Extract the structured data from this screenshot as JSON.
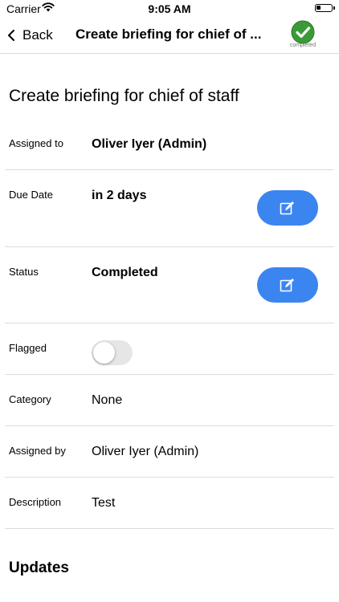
{
  "status_bar": {
    "carrier": "Carrier",
    "time": "9:05 AM"
  },
  "nav": {
    "back_label": "Back",
    "title": "Create briefing for chief of ...",
    "status_caption": "completed"
  },
  "page": {
    "title": "Create briefing for chief of staff"
  },
  "fields": {
    "assigned_to": {
      "label": "Assigned to",
      "value": "Oliver Iyer (Admin)"
    },
    "due_date": {
      "label": "Due Date",
      "value": "in 2 days"
    },
    "status": {
      "label": "Status",
      "value": "Completed"
    },
    "flagged": {
      "label": "Flagged",
      "on": false
    },
    "category": {
      "label": "Category",
      "value": "None"
    },
    "assigned_by": {
      "label": "Assigned by",
      "value": "Oliver Iyer (Admin)"
    },
    "description": {
      "label": "Description",
      "value": "Test"
    }
  },
  "updates": {
    "title": "Updates"
  },
  "colors": {
    "accent": "#3b85f1",
    "complete": "#3a9a37",
    "divider": "#dcdcdc"
  },
  "icons": [
    "wifi-icon",
    "battery-icon",
    "chevron-left-icon",
    "checkmark-circle-icon",
    "edit-icon"
  ]
}
